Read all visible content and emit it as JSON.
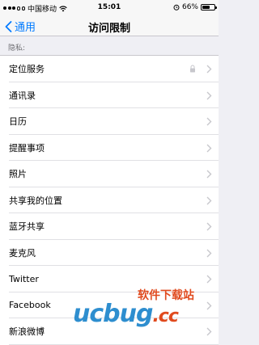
{
  "status_bar": {
    "signal_filled": 3,
    "signal_total": 5,
    "carrier": "中国移动",
    "time": "15:01",
    "battery_percent": "66%",
    "battery_level": 0.66
  },
  "nav": {
    "back_label": "通用",
    "title": "访问限制"
  },
  "section": {
    "header": "隐私:"
  },
  "items": [
    {
      "label": "定位服务",
      "locked": true
    },
    {
      "label": "通讯录"
    },
    {
      "label": "日历"
    },
    {
      "label": "提醒事项"
    },
    {
      "label": "照片"
    },
    {
      "label": "共享我的位置"
    },
    {
      "label": "蓝牙共享"
    },
    {
      "label": "麦克风"
    },
    {
      "label": "Twitter"
    },
    {
      "label": "Facebook"
    },
    {
      "label": "新浪微博"
    }
  ],
  "watermark": {
    "cn": "软件下载站",
    "en": "ucbug",
    "suffix": ".cc"
  },
  "colors": {
    "accent": "#007aff",
    "background": "#efeff4"
  }
}
